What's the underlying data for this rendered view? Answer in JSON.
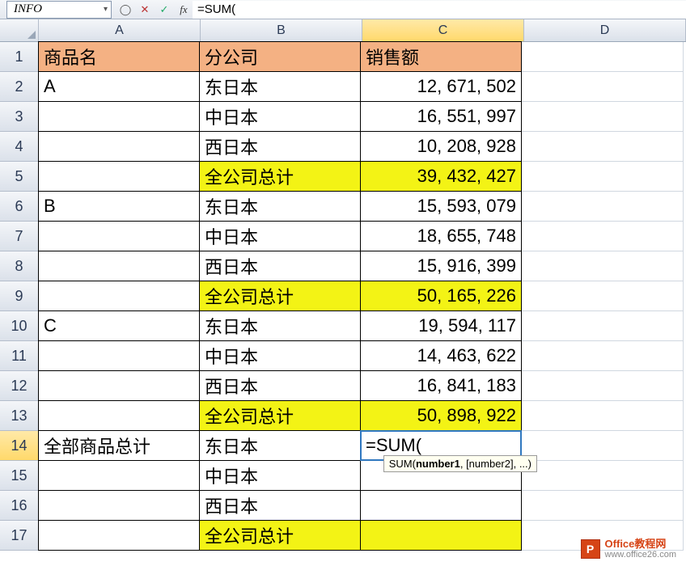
{
  "formula_bar": {
    "name_box": "INFO",
    "formula": "=SUM("
  },
  "columns": [
    "A",
    "B",
    "C",
    "D"
  ],
  "headers": {
    "a": "商品名",
    "b": "分公司",
    "c": "销售额"
  },
  "rows": [
    {
      "n": "1"
    },
    {
      "n": "2",
      "a": "A",
      "b": "东日本",
      "c": "12, 671, 502"
    },
    {
      "n": "3",
      "a": "",
      "b": "中日本",
      "c": "16, 551, 997"
    },
    {
      "n": "4",
      "a": "",
      "b": "西日本",
      "c": "10, 208, 928"
    },
    {
      "n": "5",
      "a": "",
      "b": "全公司总计",
      "c": "39, 432, 427",
      "yellow": true
    },
    {
      "n": "6",
      "a": "B",
      "b": "东日本",
      "c": "15, 593, 079"
    },
    {
      "n": "7",
      "a": "",
      "b": "中日本",
      "c": "18, 655, 748"
    },
    {
      "n": "8",
      "a": "",
      "b": "西日本",
      "c": "15, 916, 399"
    },
    {
      "n": "9",
      "a": "",
      "b": "全公司总计",
      "c": "50, 165, 226",
      "yellow": true
    },
    {
      "n": "10",
      "a": "C",
      "b": "东日本",
      "c": "19, 594, 117"
    },
    {
      "n": "11",
      "a": "",
      "b": "中日本",
      "c": "14, 463, 622"
    },
    {
      "n": "12",
      "a": "",
      "b": "西日本",
      "c": "16, 841, 183"
    },
    {
      "n": "13",
      "a": "",
      "b": "全公司总计",
      "c": "50, 898, 922",
      "yellow": true
    },
    {
      "n": "14",
      "a": "全部商品总计",
      "b": "东日本",
      "c": "=SUM(",
      "active": true
    },
    {
      "n": "15",
      "a": "",
      "b": "中日本",
      "c": ""
    },
    {
      "n": "16",
      "a": "",
      "b": "西日本",
      "c": ""
    },
    {
      "n": "17",
      "a": "",
      "b": "全公司总计",
      "c": "",
      "yellow": true
    }
  ],
  "tooltip": {
    "fn": "SUM",
    "arg1": "number1",
    "rest": ", [number2], ...)"
  },
  "watermark": {
    "title": "Office教程网",
    "url": "www.office26.com",
    "icon": "P"
  }
}
